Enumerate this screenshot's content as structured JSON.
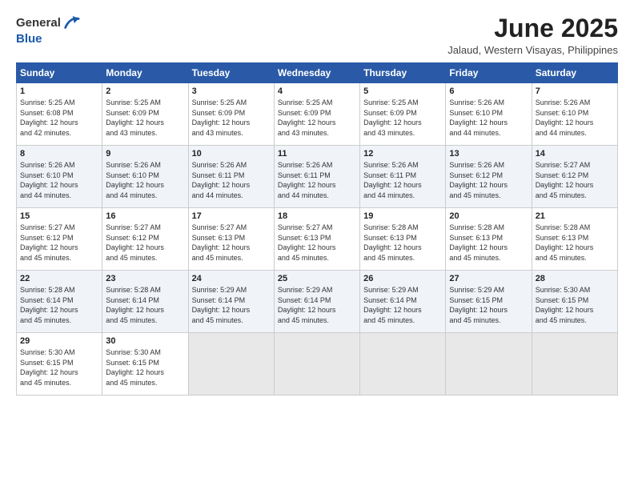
{
  "logo": {
    "line1": "General",
    "line2": "Blue"
  },
  "title": "June 2025",
  "subtitle": "Jalaud, Western Visayas, Philippines",
  "days_header": [
    "Sunday",
    "Monday",
    "Tuesday",
    "Wednesday",
    "Thursday",
    "Friday",
    "Saturday"
  ],
  "weeks": [
    [
      {
        "day": "1",
        "info": "Sunrise: 5:25 AM\nSunset: 6:08 PM\nDaylight: 12 hours\nand 42 minutes."
      },
      {
        "day": "2",
        "info": "Sunrise: 5:25 AM\nSunset: 6:09 PM\nDaylight: 12 hours\nand 43 minutes."
      },
      {
        "day": "3",
        "info": "Sunrise: 5:25 AM\nSunset: 6:09 PM\nDaylight: 12 hours\nand 43 minutes."
      },
      {
        "day": "4",
        "info": "Sunrise: 5:25 AM\nSunset: 6:09 PM\nDaylight: 12 hours\nand 43 minutes."
      },
      {
        "day": "5",
        "info": "Sunrise: 5:25 AM\nSunset: 6:09 PM\nDaylight: 12 hours\nand 43 minutes."
      },
      {
        "day": "6",
        "info": "Sunrise: 5:26 AM\nSunset: 6:10 PM\nDaylight: 12 hours\nand 44 minutes."
      },
      {
        "day": "7",
        "info": "Sunrise: 5:26 AM\nSunset: 6:10 PM\nDaylight: 12 hours\nand 44 minutes."
      }
    ],
    [
      {
        "day": "8",
        "info": "Sunrise: 5:26 AM\nSunset: 6:10 PM\nDaylight: 12 hours\nand 44 minutes."
      },
      {
        "day": "9",
        "info": "Sunrise: 5:26 AM\nSunset: 6:10 PM\nDaylight: 12 hours\nand 44 minutes."
      },
      {
        "day": "10",
        "info": "Sunrise: 5:26 AM\nSunset: 6:11 PM\nDaylight: 12 hours\nand 44 minutes."
      },
      {
        "day": "11",
        "info": "Sunrise: 5:26 AM\nSunset: 6:11 PM\nDaylight: 12 hours\nand 44 minutes."
      },
      {
        "day": "12",
        "info": "Sunrise: 5:26 AM\nSunset: 6:11 PM\nDaylight: 12 hours\nand 44 minutes."
      },
      {
        "day": "13",
        "info": "Sunrise: 5:26 AM\nSunset: 6:12 PM\nDaylight: 12 hours\nand 45 minutes."
      },
      {
        "day": "14",
        "info": "Sunrise: 5:27 AM\nSunset: 6:12 PM\nDaylight: 12 hours\nand 45 minutes."
      }
    ],
    [
      {
        "day": "15",
        "info": "Sunrise: 5:27 AM\nSunset: 6:12 PM\nDaylight: 12 hours\nand 45 minutes."
      },
      {
        "day": "16",
        "info": "Sunrise: 5:27 AM\nSunset: 6:12 PM\nDaylight: 12 hours\nand 45 minutes."
      },
      {
        "day": "17",
        "info": "Sunrise: 5:27 AM\nSunset: 6:13 PM\nDaylight: 12 hours\nand 45 minutes."
      },
      {
        "day": "18",
        "info": "Sunrise: 5:27 AM\nSunset: 6:13 PM\nDaylight: 12 hours\nand 45 minutes."
      },
      {
        "day": "19",
        "info": "Sunrise: 5:28 AM\nSunset: 6:13 PM\nDaylight: 12 hours\nand 45 minutes."
      },
      {
        "day": "20",
        "info": "Sunrise: 5:28 AM\nSunset: 6:13 PM\nDaylight: 12 hours\nand 45 minutes."
      },
      {
        "day": "21",
        "info": "Sunrise: 5:28 AM\nSunset: 6:13 PM\nDaylight: 12 hours\nand 45 minutes."
      }
    ],
    [
      {
        "day": "22",
        "info": "Sunrise: 5:28 AM\nSunset: 6:14 PM\nDaylight: 12 hours\nand 45 minutes."
      },
      {
        "day": "23",
        "info": "Sunrise: 5:28 AM\nSunset: 6:14 PM\nDaylight: 12 hours\nand 45 minutes."
      },
      {
        "day": "24",
        "info": "Sunrise: 5:29 AM\nSunset: 6:14 PM\nDaylight: 12 hours\nand 45 minutes."
      },
      {
        "day": "25",
        "info": "Sunrise: 5:29 AM\nSunset: 6:14 PM\nDaylight: 12 hours\nand 45 minutes."
      },
      {
        "day": "26",
        "info": "Sunrise: 5:29 AM\nSunset: 6:14 PM\nDaylight: 12 hours\nand 45 minutes."
      },
      {
        "day": "27",
        "info": "Sunrise: 5:29 AM\nSunset: 6:15 PM\nDaylight: 12 hours\nand 45 minutes."
      },
      {
        "day": "28",
        "info": "Sunrise: 5:30 AM\nSunset: 6:15 PM\nDaylight: 12 hours\nand 45 minutes."
      }
    ],
    [
      {
        "day": "29",
        "info": "Sunrise: 5:30 AM\nSunset: 6:15 PM\nDaylight: 12 hours\nand 45 minutes."
      },
      {
        "day": "30",
        "info": "Sunrise: 5:30 AM\nSunset: 6:15 PM\nDaylight: 12 hours\nand 45 minutes."
      },
      {
        "day": "",
        "info": ""
      },
      {
        "day": "",
        "info": ""
      },
      {
        "day": "",
        "info": ""
      },
      {
        "day": "",
        "info": ""
      },
      {
        "day": "",
        "info": ""
      }
    ]
  ]
}
